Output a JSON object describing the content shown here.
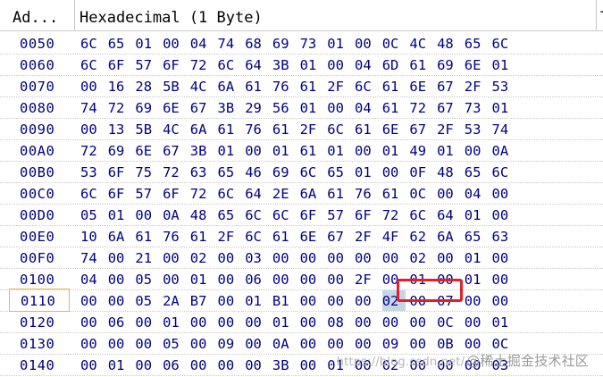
{
  "header": {
    "address_col": "Ad...",
    "hex_col": "Hexadecimal (1 Byte)",
    "text_col": "T"
  },
  "rows": [
    {
      "addr": "0050",
      "bytes": [
        "6C",
        "65",
        "01",
        "00",
        "04",
        "74",
        "68",
        "69",
        "73",
        "01",
        "00",
        "0C",
        "4C",
        "48",
        "65",
        "6C"
      ]
    },
    {
      "addr": "0060",
      "bytes": [
        "6C",
        "6F",
        "57",
        "6F",
        "72",
        "6C",
        "64",
        "3B",
        "01",
        "00",
        "04",
        "6D",
        "61",
        "69",
        "6E",
        "01"
      ]
    },
    {
      "addr": "0070",
      "bytes": [
        "00",
        "16",
        "28",
        "5B",
        "4C",
        "6A",
        "61",
        "76",
        "61",
        "2F",
        "6C",
        "61",
        "6E",
        "67",
        "2F",
        "53"
      ]
    },
    {
      "addr": "0080",
      "bytes": [
        "74",
        "72",
        "69",
        "6E",
        "67",
        "3B",
        "29",
        "56",
        "01",
        "00",
        "04",
        "61",
        "72",
        "67",
        "73",
        "01"
      ]
    },
    {
      "addr": "0090",
      "bytes": [
        "00",
        "13",
        "5B",
        "4C",
        "6A",
        "61",
        "76",
        "61",
        "2F",
        "6C",
        "61",
        "6E",
        "67",
        "2F",
        "53",
        "74"
      ]
    },
    {
      "addr": "00A0",
      "bytes": [
        "72",
        "69",
        "6E",
        "67",
        "3B",
        "01",
        "00",
        "01",
        "61",
        "01",
        "00",
        "01",
        "49",
        "01",
        "00",
        "0A"
      ]
    },
    {
      "addr": "00B0",
      "bytes": [
        "53",
        "6F",
        "75",
        "72",
        "63",
        "65",
        "46",
        "69",
        "6C",
        "65",
        "01",
        "00",
        "0F",
        "48",
        "65",
        "6C"
      ]
    },
    {
      "addr": "00C0",
      "bytes": [
        "6C",
        "6F",
        "57",
        "6F",
        "72",
        "6C",
        "64",
        "2E",
        "6A",
        "61",
        "76",
        "61",
        "0C",
        "00",
        "04",
        "00"
      ]
    },
    {
      "addr": "00D0",
      "bytes": [
        "05",
        "01",
        "00",
        "0A",
        "48",
        "65",
        "6C",
        "6C",
        "6F",
        "57",
        "6F",
        "72",
        "6C",
        "64",
        "01",
        "00"
      ]
    },
    {
      "addr": "00E0",
      "bytes": [
        "10",
        "6A",
        "61",
        "76",
        "61",
        "2F",
        "6C",
        "61",
        "6E",
        "67",
        "2F",
        "4F",
        "62",
        "6A",
        "65",
        "63"
      ]
    },
    {
      "addr": "00F0",
      "bytes": [
        "74",
        "00",
        "21",
        "00",
        "02",
        "00",
        "03",
        "00",
        "00",
        "00",
        "00",
        "00",
        "02",
        "00",
        "01",
        "00"
      ]
    },
    {
      "addr": "0100",
      "bytes": [
        "04",
        "00",
        "05",
        "00",
        "01",
        "00",
        "06",
        "00",
        "00",
        "00",
        "2F",
        "00",
        "01",
        "00",
        "01",
        "00"
      ]
    },
    {
      "addr": "0110",
      "bytes": [
        "00",
        "00",
        "05",
        "2A",
        "B7",
        "00",
        "01",
        "B1",
        "00",
        "00",
        "00",
        "02",
        "00",
        "07",
        "00",
        "00"
      ]
    },
    {
      "addr": "0120",
      "bytes": [
        "00",
        "06",
        "00",
        "01",
        "00",
        "00",
        "00",
        "01",
        "00",
        "08",
        "00",
        "00",
        "00",
        "0C",
        "00",
        "01"
      ]
    },
    {
      "addr": "0130",
      "bytes": [
        "00",
        "00",
        "00",
        "05",
        "00",
        "09",
        "00",
        "0A",
        "00",
        "00",
        "00",
        "09",
        "00",
        "0B",
        "00",
        "0C"
      ]
    },
    {
      "addr": "0140",
      "bytes": [
        "00",
        "01",
        "00",
        "06",
        "00",
        "00",
        "00",
        "3B",
        "00",
        "01",
        "00",
        "02",
        "00",
        "00",
        "00",
        "03"
      ]
    }
  ],
  "selected_row": 12,
  "highlighted_byte_index": 11,
  "annotation_box_bytes": [
    10,
    11
  ],
  "colors": {
    "hex_text": "#000080",
    "highlight": "#c7d6e6",
    "annotation_box": "#e0202a",
    "selected_border": "#e8b54a"
  },
  "watermark": {
    "url": "https://blog.csdn.net/",
    "site": "@稀土掘金技术社区"
  }
}
